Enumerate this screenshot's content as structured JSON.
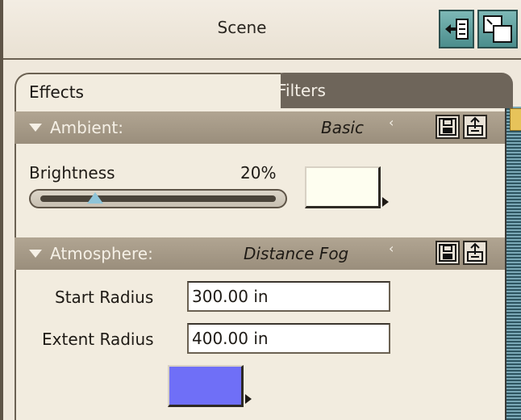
{
  "window": {
    "title": "Scene"
  },
  "tabs": [
    {
      "label": "Effects",
      "active": true
    },
    {
      "label": "Filters",
      "active": false
    }
  ],
  "ambient": {
    "section_label": "Ambient:",
    "preset": "Basic",
    "brightness_label": "Brightness",
    "brightness_value": "20%",
    "brightness_fraction": 0.2,
    "color": "#fefef0"
  },
  "atmosphere": {
    "section_label": "Atmosphere:",
    "preset": "Distance Fog",
    "start_radius_label": "Start Radius",
    "start_radius_value": "300.00 in",
    "extent_radius_label": "Extent Radius",
    "extent_radius_value": "400.00 in",
    "color": "#6f6ff7"
  },
  "icons": {
    "chevron": "double-chevron-down-icon",
    "save": "save-preset-icon",
    "load": "load-preset-icon"
  }
}
